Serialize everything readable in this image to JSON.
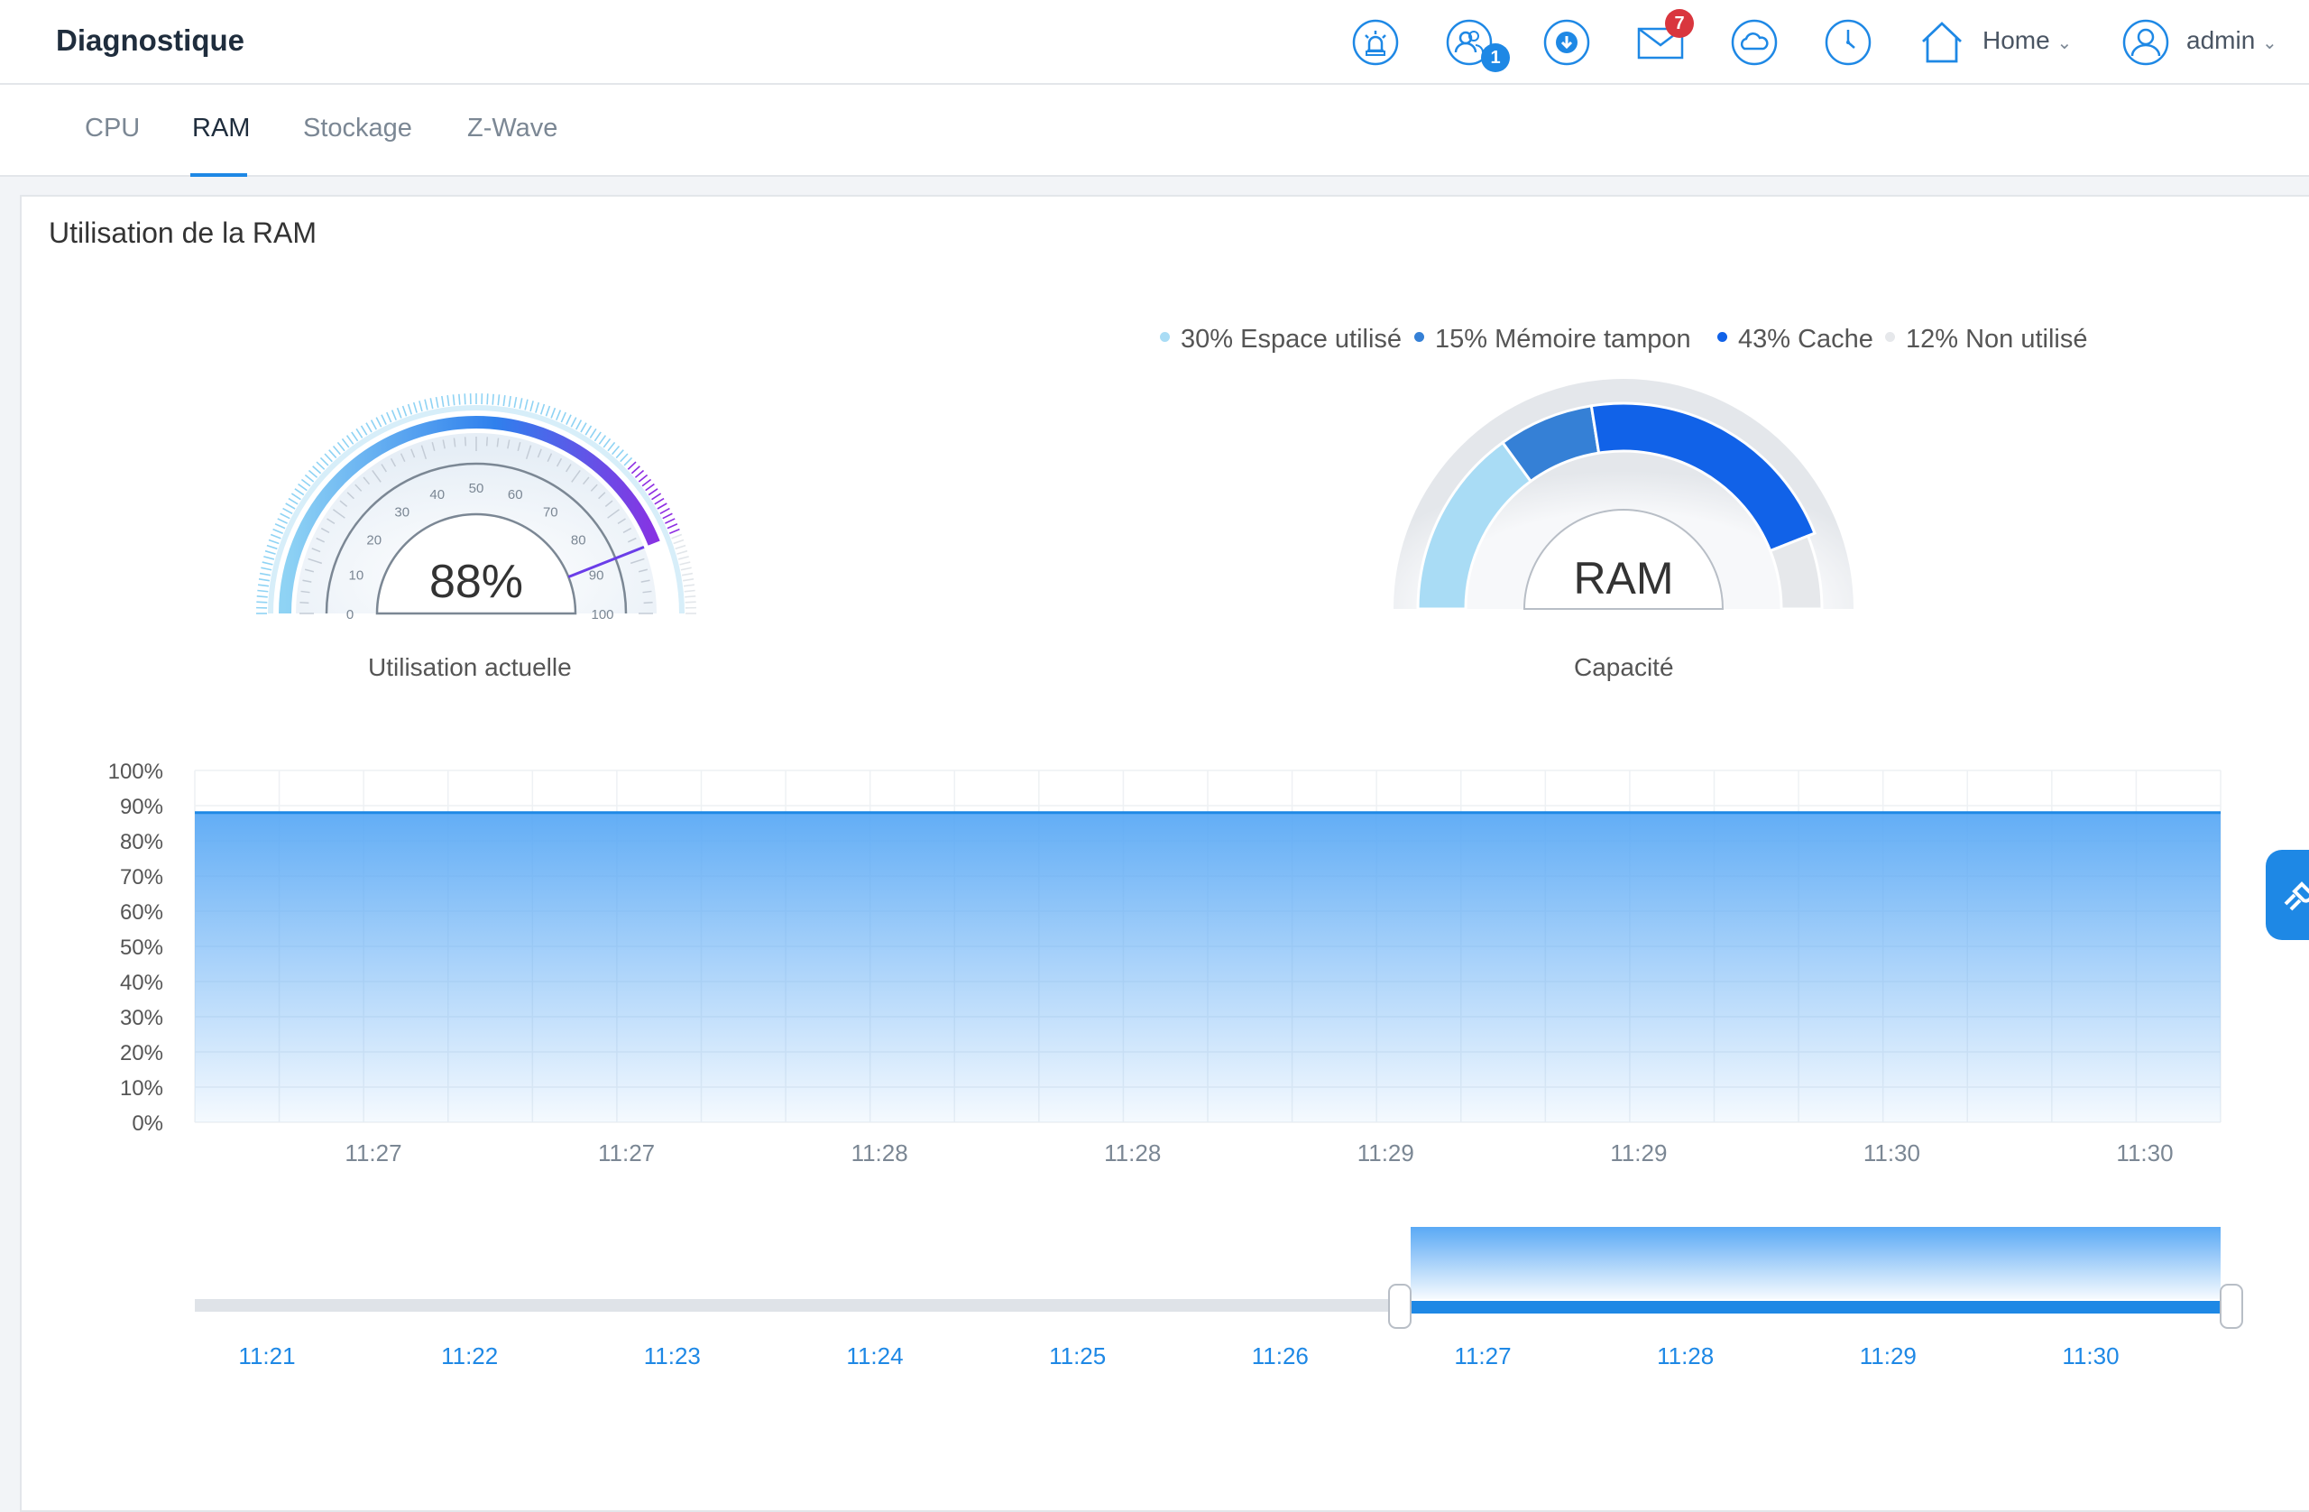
{
  "header": {
    "title": "Diagnostique",
    "icons": [
      "alarm-icon",
      "users-icon",
      "download-icon",
      "mail-icon",
      "weather-icon",
      "clock-icon",
      "home-icon",
      "user-icon"
    ],
    "users_badge": "1",
    "mail_badge": "7",
    "home_label": "Home",
    "user_label": "admin"
  },
  "tabs": [
    {
      "label": "CPU"
    },
    {
      "label": "RAM"
    },
    {
      "label": "Stockage"
    },
    {
      "label": "Z-Wave"
    }
  ],
  "card": {
    "title": "Utilisation de la RAM",
    "speed_gauge": {
      "value_label": "88%",
      "value": 88,
      "ticks": [
        "0",
        "10",
        "20",
        "30",
        "40",
        "50",
        "60",
        "70",
        "80",
        "90",
        "100"
      ],
      "caption": "Utilisation actuelle"
    },
    "capacity_gauge": {
      "center_label": "RAM",
      "caption": "Capacité",
      "legend": [
        {
          "label": "30% Espace utilisé",
          "percent": 30,
          "color": "#a9dcf5"
        },
        {
          "label": "15% Mémoire tampon",
          "percent": 15,
          "color": "#3580d6"
        },
        {
          "label": "43% Cache",
          "percent": 43,
          "color": "#1162e8"
        },
        {
          "label": "12% Non utilisé",
          "percent": 12,
          "color": "#e6e8eb"
        }
      ]
    }
  },
  "chart_data": {
    "type": "area",
    "y_tick_labels": [
      "0%",
      "10%",
      "20%",
      "30%",
      "40%",
      "50%",
      "60%",
      "70%",
      "80%",
      "90%",
      "100%"
    ],
    "ylim": [
      0,
      100
    ],
    "x_tick_labels": [
      "11:27",
      "11:27",
      "11:28",
      "11:28",
      "11:29",
      "11:29",
      "11:30",
      "11:30"
    ],
    "series": [
      {
        "values": [
          88,
          88,
          88,
          88,
          88,
          88,
          88,
          88,
          88,
          88,
          88,
          88,
          88,
          88,
          88,
          88,
          88,
          88,
          88,
          88,
          88,
          88,
          88,
          88,
          88
        ]
      }
    ],
    "color": "#1e88e5",
    "grid": true,
    "navigator": {
      "labels": [
        "11:21",
        "11:22",
        "11:23",
        "11:24",
        "11:25",
        "11:26",
        "11:27",
        "11:28",
        "11:29",
        "11:30"
      ],
      "selected_from": "11:27",
      "selected_to": "11:30"
    }
  }
}
